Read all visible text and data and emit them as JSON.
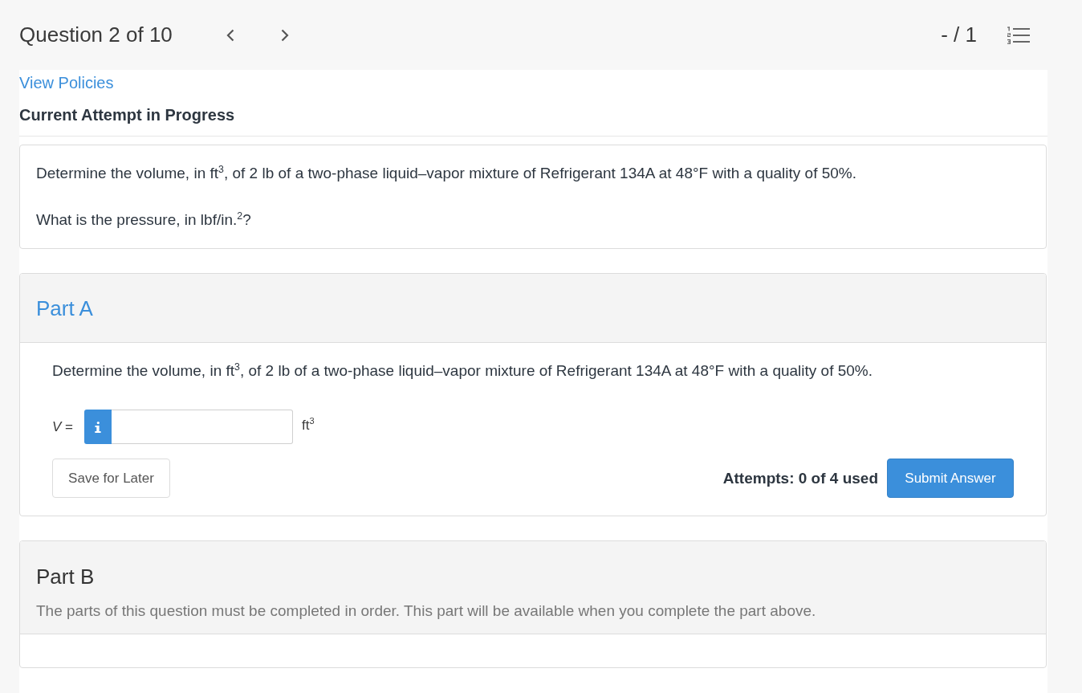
{
  "header": {
    "title": "Question 2 of 10",
    "score": "- / 1"
  },
  "policies_link": "View Policies",
  "attempt_heading": "Current Attempt in Progress",
  "question": {
    "paragraphs": [
      "Determine the volume, in ft$^{3}$, of 2 lb of a two-phase liquid–vapor mixture of Refrigerant 134A at 48°F with a quality of 50%.",
      "What is the pressure, in lbf/in.$^{2}$?"
    ]
  },
  "parts": [
    {
      "kind": "active",
      "title": "Part A",
      "prompt": "Determine the volume, in ft$^{3}$, of 2 lb of a two-phase liquid–vapor mixture of Refrigerant 134A at 48°F with a quality of 50%.",
      "answer": {
        "label": "*V* =",
        "unit": "ft$^{3}$"
      },
      "save_button": "Save for Later",
      "attempts": "Attempts: 0 of 4 used",
      "submit_button": "Submit Answer"
    },
    {
      "kind": "locked",
      "title": "Part B",
      "note": "The parts of this question must be completed in order. This part will be available when you complete the part above."
    }
  ]
}
